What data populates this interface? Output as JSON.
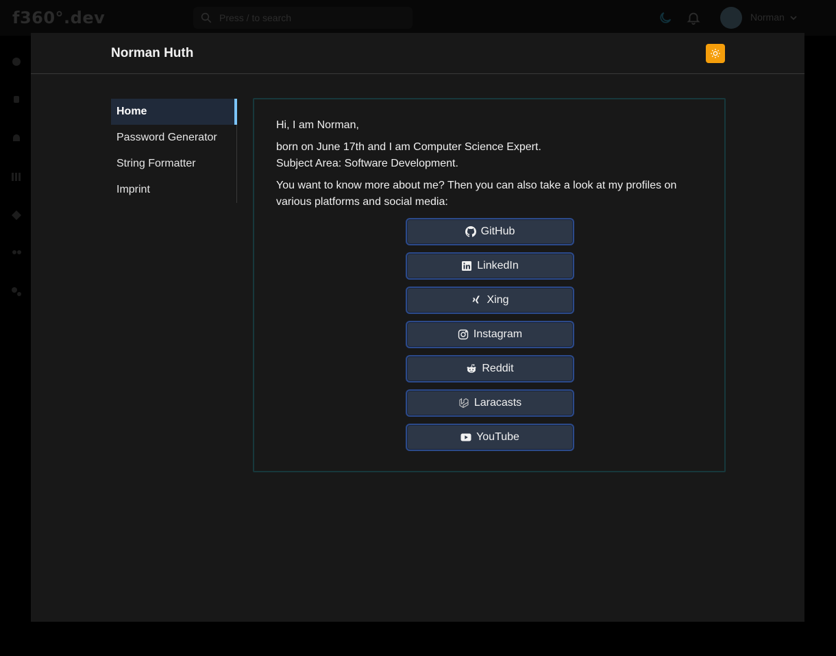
{
  "background": {
    "logo": "f360°.dev",
    "search_placeholder": "Press / to search",
    "user_name": "Norman"
  },
  "modal": {
    "title": "Norman Huth",
    "theme_toggle_icon": "sun-icon",
    "accent_color": "#f59e0b"
  },
  "nav": {
    "items": [
      {
        "label": "Home",
        "active": true
      },
      {
        "label": "Password Generator",
        "active": false
      },
      {
        "label": "String Formatter",
        "active": false
      },
      {
        "label": "Imprint",
        "active": false
      }
    ]
  },
  "content": {
    "greeting": "Hi, I am Norman,",
    "bio_line1": "born on June 17th and I am Computer Science Expert.",
    "bio_line2": "Subject Area: Software Development.",
    "profiles_intro": "You want to know more about me? Then you can also take a look at my profiles on various platforms and social media:",
    "links": [
      {
        "label": "GitHub",
        "icon": "github-icon"
      },
      {
        "label": "LinkedIn",
        "icon": "linkedin-icon"
      },
      {
        "label": "Xing",
        "icon": "xing-icon"
      },
      {
        "label": "Instagram",
        "icon": "instagram-icon"
      },
      {
        "label": "Reddit",
        "icon": "reddit-icon"
      },
      {
        "label": "Laracasts",
        "icon": "laracasts-icon"
      },
      {
        "label": "YouTube",
        "icon": "youtube-icon"
      }
    ]
  }
}
